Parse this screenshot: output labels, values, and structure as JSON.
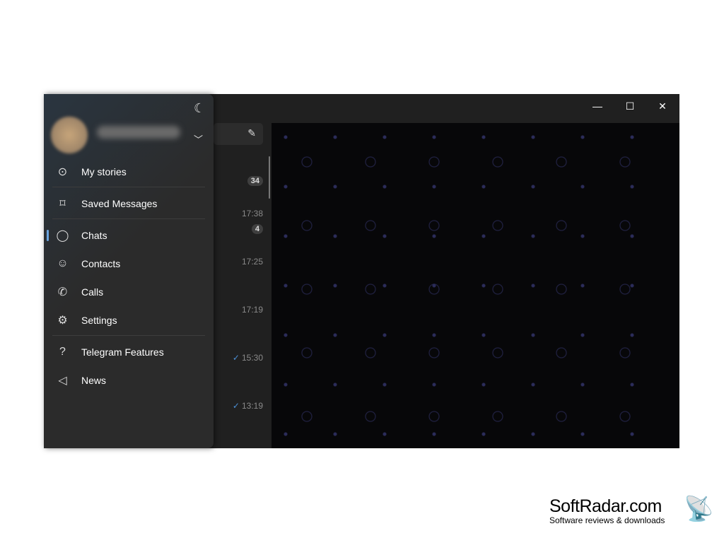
{
  "window": {
    "minimize": "—",
    "maximize": "☐",
    "close": "✕"
  },
  "chat_list": {
    "badges": [
      "34",
      "4"
    ],
    "times": [
      {
        "t": "17:38",
        "read": false
      },
      {
        "t": "17:25",
        "read": false
      },
      {
        "t": "17:19",
        "read": false
      },
      {
        "t": "15:30",
        "read": true
      },
      {
        "t": "13:19",
        "read": true
      }
    ]
  },
  "menu": {
    "items": [
      {
        "label": "My stories",
        "icon": "stories-icon",
        "glyph": "⊙"
      },
      {
        "label": "Saved Messages",
        "icon": "bookmark-icon",
        "glyph": "⌑"
      },
      {
        "label": "Chats",
        "icon": "chats-icon",
        "glyph": "◯"
      },
      {
        "label": "Contacts",
        "icon": "contacts-icon",
        "glyph": "☺"
      },
      {
        "label": "Calls",
        "icon": "phone-icon",
        "glyph": "✆"
      },
      {
        "label": "Settings",
        "icon": "gear-icon",
        "glyph": "⚙"
      },
      {
        "label": "Telegram Features",
        "icon": "help-icon",
        "glyph": "?"
      },
      {
        "label": "News",
        "icon": "megaphone-icon",
        "glyph": "◁"
      }
    ],
    "active": "Chats"
  },
  "watermark": {
    "brand": "SoftRadar.com",
    "tagline": "Software reviews & downloads"
  },
  "colors": {
    "accent": "#6aa4e0",
    "check": "#4b8fd6"
  }
}
